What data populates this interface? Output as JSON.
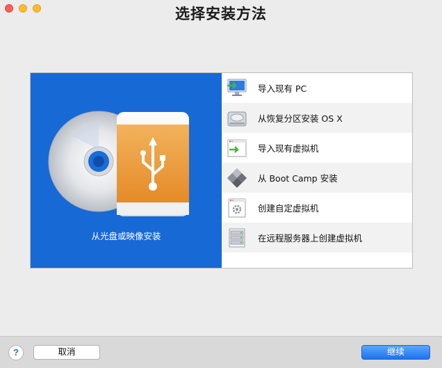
{
  "window": {
    "title": "选择安装方法",
    "traffic_colors": [
      "#ff5f57",
      "#febc2e",
      "#febc2e"
    ]
  },
  "left_panel": {
    "label": "从光盘或映像安装",
    "bg_color": "#1769d6"
  },
  "methods": [
    {
      "label": "导入现有 PC",
      "icon": "pc-import-icon"
    },
    {
      "label": "从恢复分区安装 OS X",
      "icon": "hard-disk-icon"
    },
    {
      "label": "导入现有虚拟机",
      "icon": "vm-import-icon"
    },
    {
      "label": "从 Boot Camp 安装",
      "icon": "boot-camp-icon"
    },
    {
      "label": "创建自定虚拟机",
      "icon": "custom-vm-icon"
    },
    {
      "label": "在远程服务器上创建虚拟机",
      "icon": "remote-server-icon"
    }
  ],
  "footer": {
    "help_label": "?",
    "cancel_label": "取消",
    "continue_label": "继续"
  }
}
